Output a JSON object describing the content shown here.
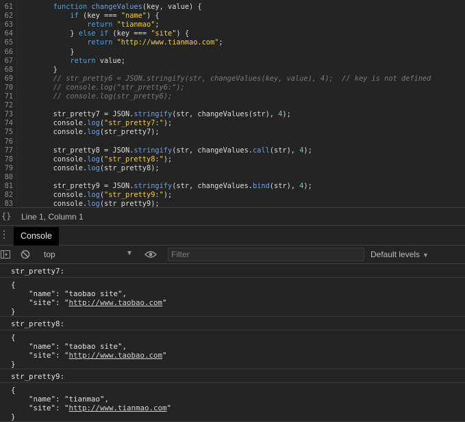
{
  "editor": {
    "lines": [
      {
        "n": "61",
        "tokens": [
          [
            "        ",
            ""
          ],
          [
            "function",
            "kw"
          ],
          [
            " ",
            ""
          ],
          [
            "changeValues",
            "fn"
          ],
          [
            "(key, value) {",
            ""
          ]
        ]
      },
      {
        "n": "62",
        "tokens": [
          [
            "            ",
            ""
          ],
          [
            "if",
            "kw"
          ],
          [
            " (key === ",
            ""
          ],
          [
            "\"name\"",
            "str"
          ],
          [
            ") {",
            ""
          ]
        ]
      },
      {
        "n": "63",
        "tokens": [
          [
            "                ",
            ""
          ],
          [
            "return",
            "kw"
          ],
          [
            " ",
            ""
          ],
          [
            "\"tianmao\"",
            "str"
          ],
          [
            ";",
            ""
          ]
        ]
      },
      {
        "n": "64",
        "tokens": [
          [
            "            } ",
            ""
          ],
          [
            "else",
            "kw"
          ],
          [
            " ",
            ""
          ],
          [
            "if",
            "kw"
          ],
          [
            " (key === ",
            ""
          ],
          [
            "\"site\"",
            "str"
          ],
          [
            ") {",
            ""
          ]
        ]
      },
      {
        "n": "65",
        "tokens": [
          [
            "                ",
            ""
          ],
          [
            "return",
            "kw"
          ],
          [
            " ",
            ""
          ],
          [
            "\"http://www.tianmao.com\"",
            "str"
          ],
          [
            ";",
            ""
          ]
        ]
      },
      {
        "n": "66",
        "tokens": [
          [
            "            }",
            ""
          ]
        ]
      },
      {
        "n": "67",
        "tokens": [
          [
            "            ",
            ""
          ],
          [
            "return",
            "kw"
          ],
          [
            " value;",
            ""
          ]
        ]
      },
      {
        "n": "68",
        "tokens": [
          [
            "        }",
            ""
          ]
        ]
      },
      {
        "n": "69",
        "tokens": [
          [
            "        ",
            ""
          ],
          [
            "// str_pretty6 = JSON.stringify(str, changeValues(key, value), 4);  // key is not defined",
            "cm"
          ]
        ]
      },
      {
        "n": "70",
        "tokens": [
          [
            "        ",
            ""
          ],
          [
            "// console.log(\"str_pretty6:\");",
            "cm"
          ]
        ]
      },
      {
        "n": "71",
        "tokens": [
          [
            "        ",
            ""
          ],
          [
            "// console.log(str_pretty6);",
            "cm"
          ]
        ]
      },
      {
        "n": "72",
        "tokens": []
      },
      {
        "n": "73",
        "tokens": [
          [
            "        str_pretty7 = JSON.",
            ""
          ],
          [
            "stringify",
            "fn"
          ],
          [
            "(str, changeValues(str), ",
            ""
          ],
          [
            "4",
            "num"
          ],
          [
            ");",
            ""
          ]
        ]
      },
      {
        "n": "74",
        "tokens": [
          [
            "        console.",
            ""
          ],
          [
            "log",
            "fn"
          ],
          [
            "(",
            ""
          ],
          [
            "\"str_pretty7:\"",
            "str"
          ],
          [
            ");",
            ""
          ]
        ]
      },
      {
        "n": "75",
        "tokens": [
          [
            "        console.",
            ""
          ],
          [
            "log",
            "fn"
          ],
          [
            "(str_pretty7);",
            ""
          ]
        ]
      },
      {
        "n": "76",
        "tokens": []
      },
      {
        "n": "77",
        "tokens": [
          [
            "        str_pretty8 = JSON.",
            ""
          ],
          [
            "stringify",
            "fn"
          ],
          [
            "(str, changeValues.",
            ""
          ],
          [
            "call",
            "fn"
          ],
          [
            "(str), ",
            ""
          ],
          [
            "4",
            "num"
          ],
          [
            ");",
            ""
          ]
        ]
      },
      {
        "n": "78",
        "tokens": [
          [
            "        console.",
            ""
          ],
          [
            "log",
            "fn"
          ],
          [
            "(",
            ""
          ],
          [
            "\"str_pretty8:\"",
            "str"
          ],
          [
            ");",
            ""
          ]
        ]
      },
      {
        "n": "79",
        "tokens": [
          [
            "        console.",
            ""
          ],
          [
            "log",
            "fn"
          ],
          [
            "(str_pretty8);",
            ""
          ]
        ]
      },
      {
        "n": "80",
        "tokens": []
      },
      {
        "n": "81",
        "tokens": [
          [
            "        str_pretty9 = JSON.",
            ""
          ],
          [
            "stringify",
            "fn"
          ],
          [
            "(str, changeValues.",
            ""
          ],
          [
            "bind",
            "fn"
          ],
          [
            "(str), ",
            ""
          ],
          [
            "4",
            "num"
          ],
          [
            ");",
            ""
          ]
        ]
      },
      {
        "n": "82",
        "tokens": [
          [
            "        console.",
            ""
          ],
          [
            "log",
            "fn"
          ],
          [
            "(",
            ""
          ],
          [
            "\"str_pretty9:\"",
            "str"
          ],
          [
            ");",
            ""
          ]
        ]
      },
      {
        "n": "83",
        "tokens": [
          [
            "        console.",
            ""
          ],
          [
            "log",
            "fn"
          ],
          [
            "(str_pretty9);",
            ""
          ]
        ]
      }
    ]
  },
  "statusbar": {
    "braces": "{}",
    "cursor": "Line 1, Column 1"
  },
  "drawer": {
    "tab": "Console"
  },
  "toolbar": {
    "context": "top",
    "filter_placeholder": "Filter",
    "levels": "Default levels"
  },
  "output": {
    "messages": [
      {
        "text": "str_pretty7:"
      },
      {
        "obj": {
          "name": "taobao site",
          "site": "http://www.taobao.com"
        }
      },
      {
        "text": "str_pretty8:"
      },
      {
        "obj": {
          "name": "taobao site",
          "site": "http://www.taobao.com"
        }
      },
      {
        "text": "str_pretty9:"
      },
      {
        "obj": {
          "name": "tianmao",
          "site": "http://www.tianmao.com"
        }
      }
    ]
  },
  "colors": {
    "background": "#242424",
    "keyword": "#4aa3e6",
    "string": "#f3ce41",
    "number": "#7ec4a8",
    "comment": "#7b7b7b"
  }
}
